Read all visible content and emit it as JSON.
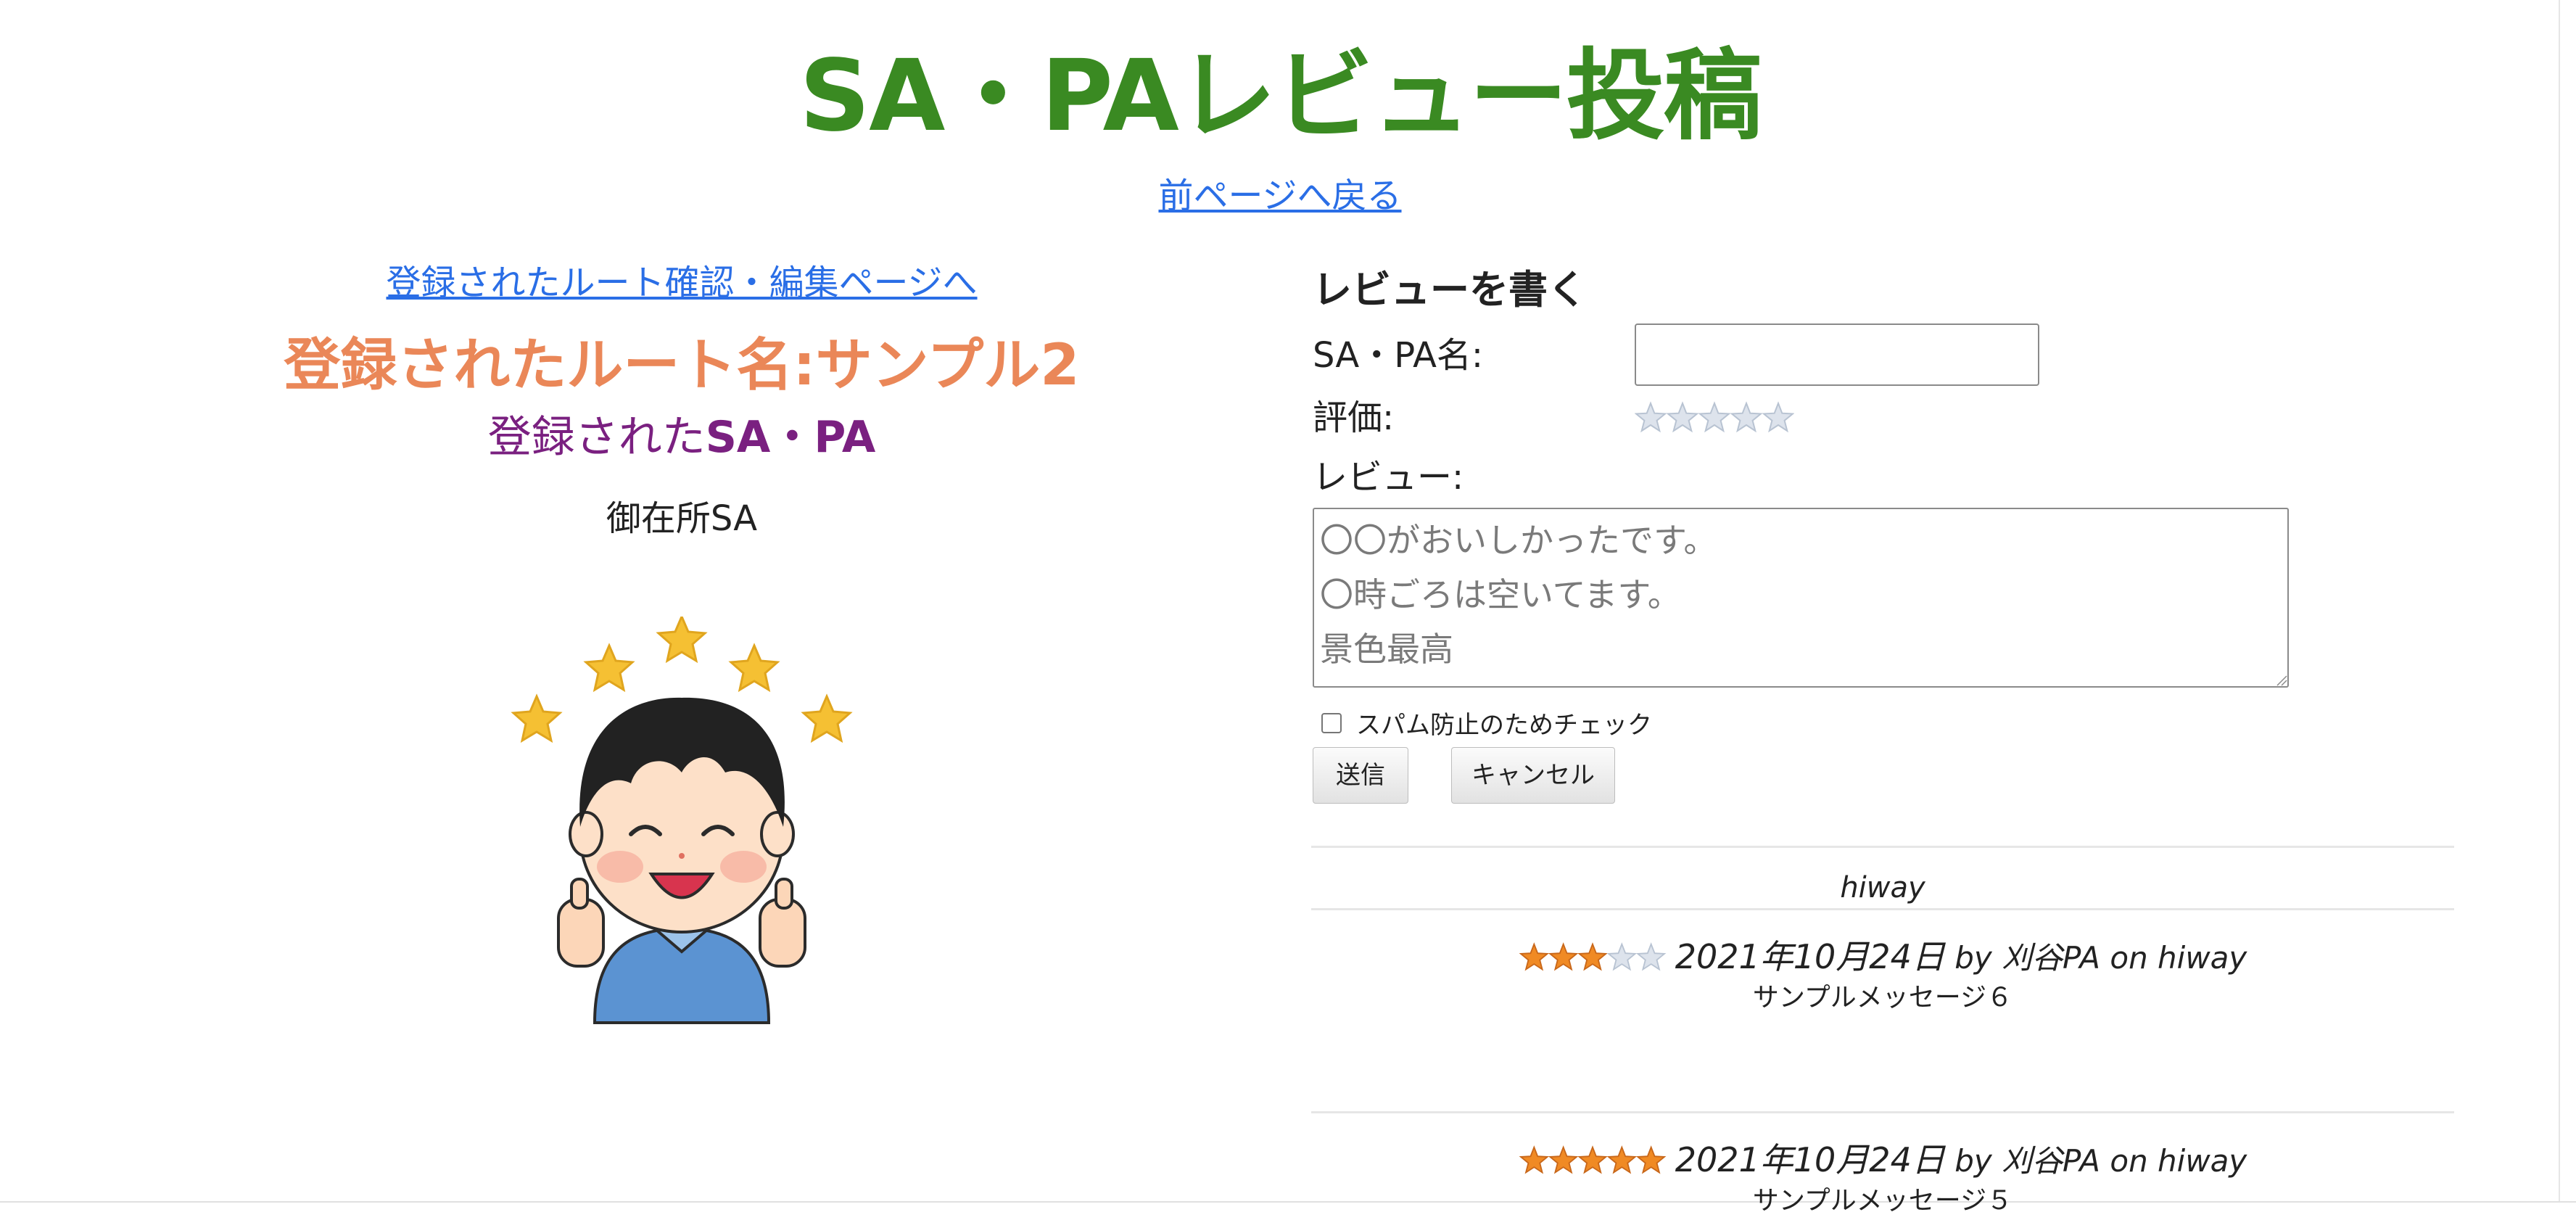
{
  "page": {
    "title": "SA・PAレビュー投稿",
    "back_link": "前ページへ戻る"
  },
  "left": {
    "route_link": "登録されたルート確認・編集ページへ",
    "route_name": "登録されたルート名:サンプル2",
    "sapa_heading_prefix": "登録された",
    "sapa_heading_strong": "SA・PA",
    "sapa_name": "御在所SA",
    "illustration_icon": "thumbs-up-boy-with-stars"
  },
  "form": {
    "heading": "レビューを書く",
    "name_label": "SA・PA名:",
    "name_value": "",
    "rating_label": "評価:",
    "rating_value": 0,
    "rating_max": 5,
    "review_label": "レビュー:",
    "review_placeholder": "〇〇がおいしかったです。\n〇時ごろは空いてます。\n景色最高",
    "spam_label": "スパム防止のためチェック",
    "spam_checked": false,
    "send_label": "送信",
    "cancel_label": "キャンセル"
  },
  "reviews": {
    "site": "hiway",
    "items": [
      {
        "rating": 3,
        "date": "2021年10月24日",
        "byline": " by 刈谷PA on hiway",
        "message": "サンプルメッセージ６"
      },
      {
        "rating": 5,
        "date": "2021年10月24日",
        "byline": " by 刈谷PA on hiway",
        "message": "サンプルメッセージ５"
      }
    ]
  },
  "colors": {
    "title": "#3a8a22",
    "link": "#2a6ee6",
    "route_name": "#ea8758",
    "sapa_heading": "#7a2080",
    "star_filled": "#f08a24",
    "star_empty": "#dde3ec"
  }
}
